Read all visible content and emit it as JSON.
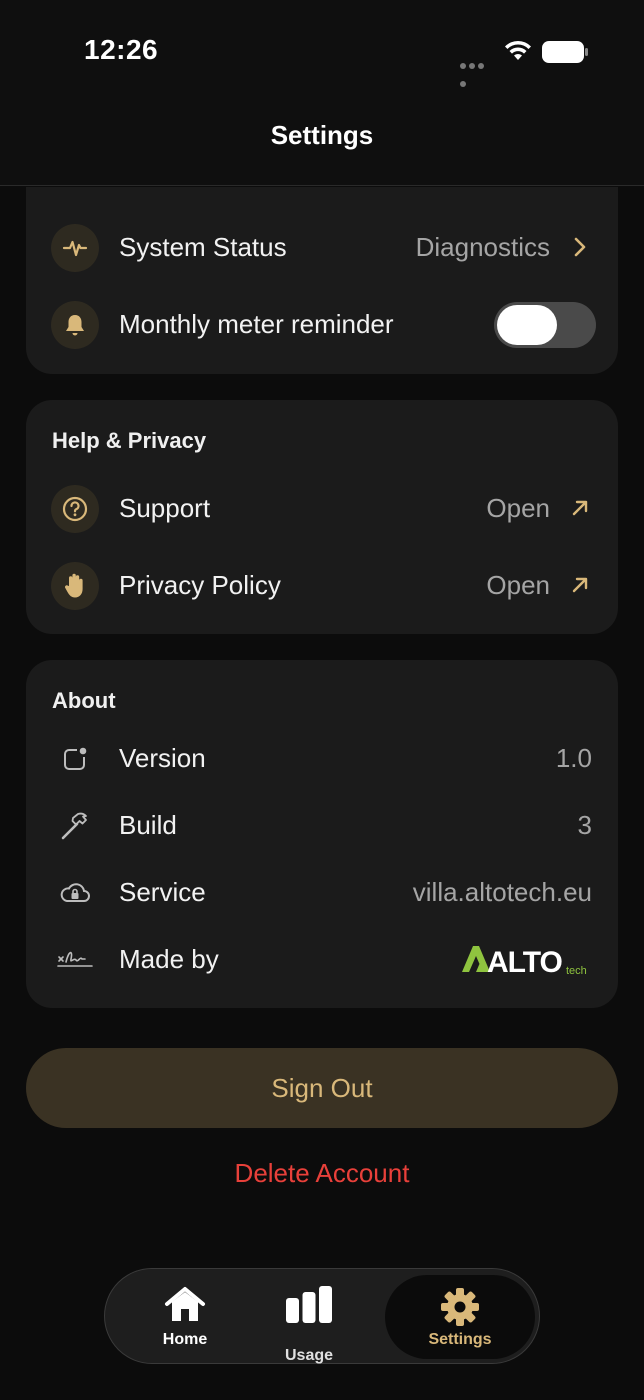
{
  "status_bar": {
    "time": "12:26"
  },
  "header": {
    "title": "Settings"
  },
  "system": {
    "rows": [
      {
        "label": "System Status",
        "value": "Diagnostics"
      },
      {
        "label": "Monthly meter reminder",
        "toggle_on": false
      }
    ]
  },
  "help": {
    "title": "Help & Privacy",
    "rows": [
      {
        "label": "Support",
        "value": "Open"
      },
      {
        "label": "Privacy Policy",
        "value": "Open"
      }
    ]
  },
  "about": {
    "title": "About",
    "rows": [
      {
        "label": "Version",
        "value": "1.0"
      },
      {
        "label": "Build",
        "value": "3"
      },
      {
        "label": "Service",
        "value": "villa.altotech.eu"
      },
      {
        "label": "Made by",
        "logo_text": "ALTO",
        "logo_sub": "tech"
      }
    ]
  },
  "actions": {
    "sign_out": "Sign Out",
    "delete_account": "Delete Account"
  },
  "tabbar": {
    "items": [
      {
        "label": "Home"
      },
      {
        "label": "Usage"
      },
      {
        "label": "Settings",
        "active": true
      }
    ]
  },
  "colors": {
    "accent": "#d9b87a",
    "danger": "#e8403a",
    "card": "#1b1b1b",
    "background": "#0c0c0c"
  }
}
